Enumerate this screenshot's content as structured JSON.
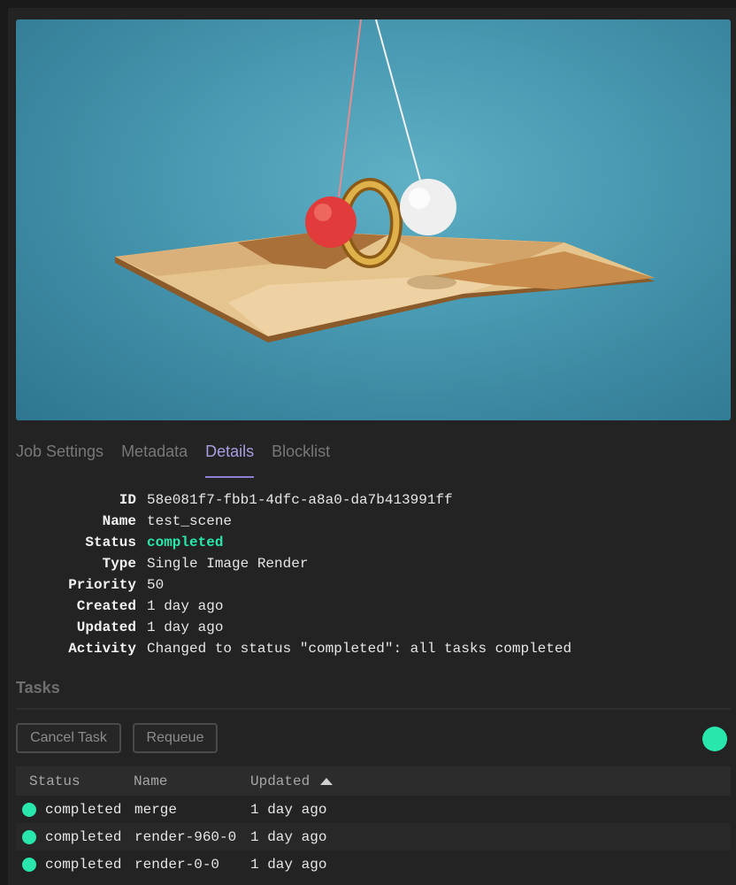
{
  "tabs": [
    {
      "label": "Job Settings"
    },
    {
      "label": "Metadata"
    },
    {
      "label": "Details"
    },
    {
      "label": "Blocklist"
    }
  ],
  "details": [
    {
      "key": "ID",
      "value": "58e081f7-fbb1-4dfc-a8a0-da7b413991ff"
    },
    {
      "key": "Name",
      "value": "test_scene"
    },
    {
      "key": "Status",
      "value": "completed"
    },
    {
      "key": "Type",
      "value": "Single Image Render"
    },
    {
      "key": "Priority",
      "value": "50"
    },
    {
      "key": "Created",
      "value": "1 day ago"
    },
    {
      "key": "Updated",
      "value": "1 day ago"
    },
    {
      "key": "Activity",
      "value": "Changed to status \"completed\": all tasks completed"
    }
  ],
  "tasks": {
    "title": "Tasks",
    "cancel_label": "Cancel Task",
    "requeue_label": "Requeue",
    "columns": {
      "status": "Status",
      "name": "Name",
      "updated": "Updated"
    },
    "rows": [
      {
        "status": "completed",
        "name": "merge",
        "updated": "1 day ago"
      },
      {
        "status": "completed",
        "name": "render-960-0",
        "updated": "1 day ago"
      },
      {
        "status": "completed",
        "name": "render-0-0",
        "updated": "1 day ago"
      }
    ]
  },
  "colors": {
    "accent": "#8f80d6",
    "status_completed": "#29e6ad"
  }
}
